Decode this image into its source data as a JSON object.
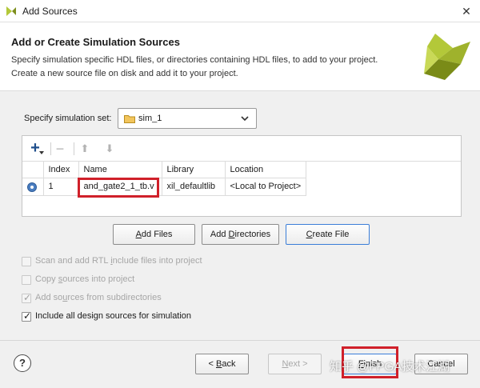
{
  "window": {
    "title": "Add Sources",
    "close_glyph": "✕"
  },
  "header": {
    "title": "Add or Create Simulation Sources",
    "description_line1": "Specify simulation specific HDL files, or directories containing HDL files, to add to your project.",
    "description_line2": "Create a new source file on disk and add it to your project.",
    "logo_icon": "vivado-logo-icon"
  },
  "simset": {
    "label": "Specify simulation set:",
    "value": "sim_1"
  },
  "toolbar": {
    "add_glyph": "+",
    "remove_glyph": "−",
    "up_glyph": "⬆",
    "down_glyph": "⬇"
  },
  "table": {
    "headers": [
      "",
      "Index",
      "Name",
      "Library",
      "Location"
    ],
    "rows": [
      {
        "index": "1",
        "name": "and_gate2_1_tb.v",
        "library": "xil_defaultlib",
        "location": "<Local to Project>"
      }
    ]
  },
  "buttons": {
    "add_files": {
      "mnemonic": "A",
      "rest": "dd Files"
    },
    "add_directories": {
      "pre": "Add ",
      "mnemonic": "D",
      "rest": "irectories"
    },
    "create_file": {
      "mnemonic": "C",
      "rest": "reate File"
    }
  },
  "options": [
    {
      "pre": "Scan and add RTL ",
      "mnemonic": "i",
      "post": "nclude files into project",
      "checked": false,
      "enabled": false
    },
    {
      "pre": "Copy ",
      "mnemonic": "s",
      "post": "ources into project",
      "checked": false,
      "enabled": false
    },
    {
      "pre": "Add so",
      "mnemonic": "u",
      "post": "rces from subdirectories",
      "checked": true,
      "enabled": false
    },
    {
      "pre": "Include all design sources for simulation",
      "mnemonic": "",
      "post": "",
      "checked": true,
      "enabled": true
    }
  ],
  "footer": {
    "help_label": "?",
    "back": {
      "pre": "< ",
      "mnemonic": "B",
      "post": "ack"
    },
    "next": {
      "pre": "",
      "mnemonic": "N",
      "post": "ext >"
    },
    "finish": {
      "mnemonic": "F",
      "post": "inish"
    },
    "cancel": "Cancel"
  },
  "watermark": "知乎 @FPGA技术江湖",
  "colors": {
    "annotation_red": "#d0202a",
    "accent_blue": "#3b7ed8",
    "logo_green": "#b3c839"
  }
}
